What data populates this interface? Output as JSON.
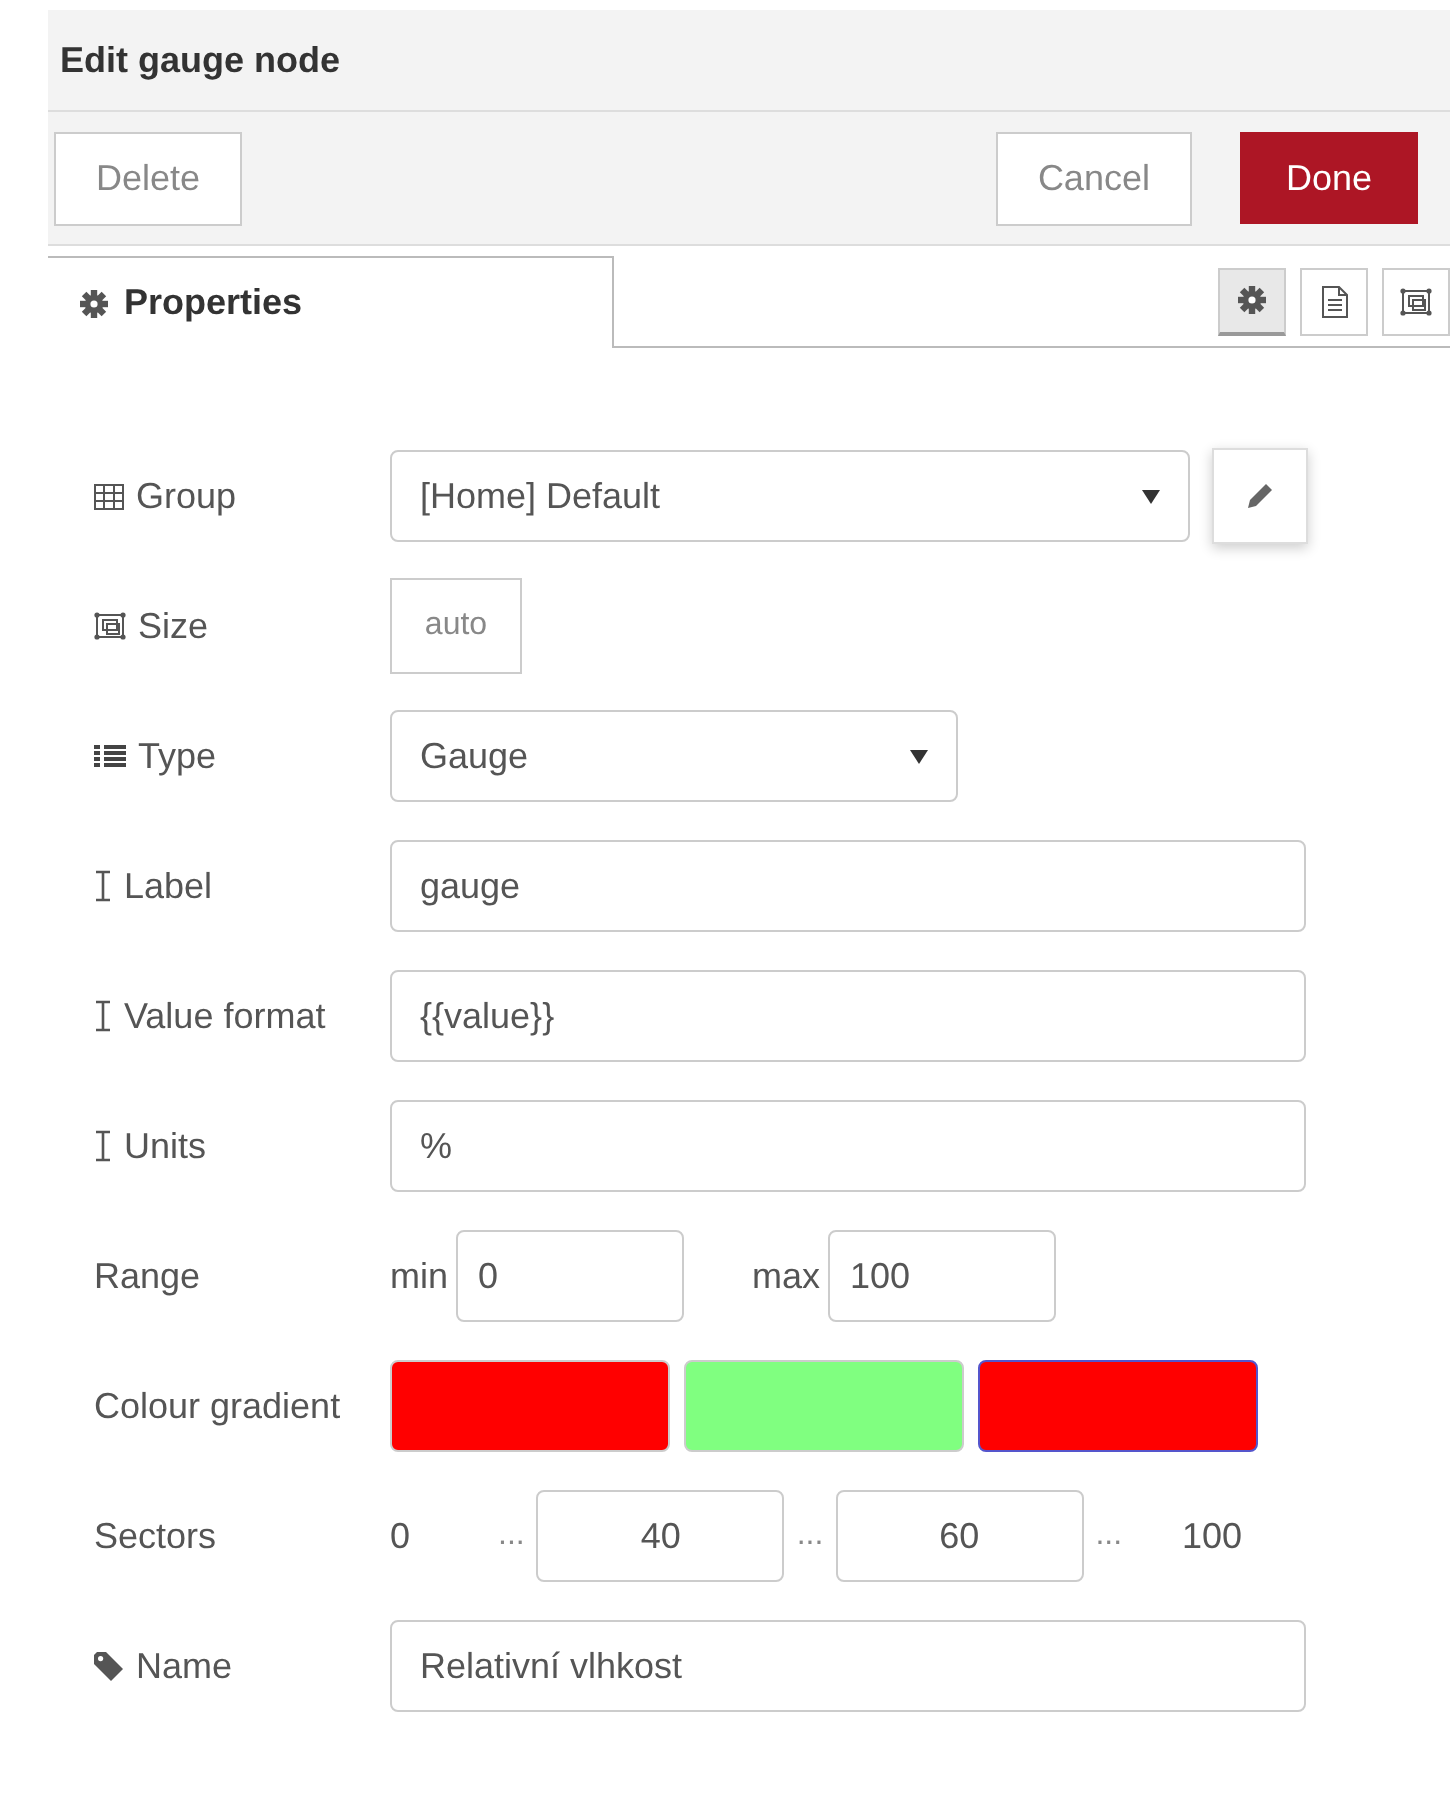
{
  "title": "Edit gauge node",
  "buttons": [
    {
      "label": "Delete",
      "kind": "plain"
    },
    {
      "label": "Cancel",
      "kind": "plain"
    },
    {
      "label": "Done",
      "kind": "primary"
    }
  ],
  "tab": {
    "label": "Properties",
    "selected": true
  },
  "tab_buttons": [
    {
      "selected": true
    },
    {
      "selected": false
    },
    {
      "selected": false
    }
  ],
  "rows": [
    {
      "kind": "select",
      "label": "Group",
      "value": "[Home] Default",
      "wide": true
    },
    {
      "kind": "size",
      "label": "Size",
      "value": "auto"
    },
    {
      "kind": "select",
      "label": "Type",
      "value": "Gauge",
      "wide": false
    },
    {
      "kind": "text",
      "label": "Label",
      "value": "gauge"
    },
    {
      "kind": "text",
      "label": "Value format",
      "value": "{{value}}"
    },
    {
      "kind": "text",
      "label": "Units",
      "value": "%"
    },
    {
      "kind": "range",
      "label": "Range",
      "min_label": "min",
      "min": "0",
      "max_label": "max",
      "max": "100"
    },
    {
      "kind": "colours",
      "label": "Colour gradient",
      "colours": [
        {
          "color": "#ff0000",
          "focused": false
        },
        {
          "color": "#80ff80",
          "focused": false
        },
        {
          "color": "#ff0000",
          "focused": true
        }
      ]
    },
    {
      "kind": "sectors",
      "label": "Sectors",
      "start": "0",
      "dots": [
        "...",
        "...",
        "..."
      ],
      "values": [
        "40",
        "60"
      ],
      "end": "100"
    },
    {
      "kind": "text",
      "label": "Name",
      "value": "Relativní vlhkost"
    }
  ]
}
